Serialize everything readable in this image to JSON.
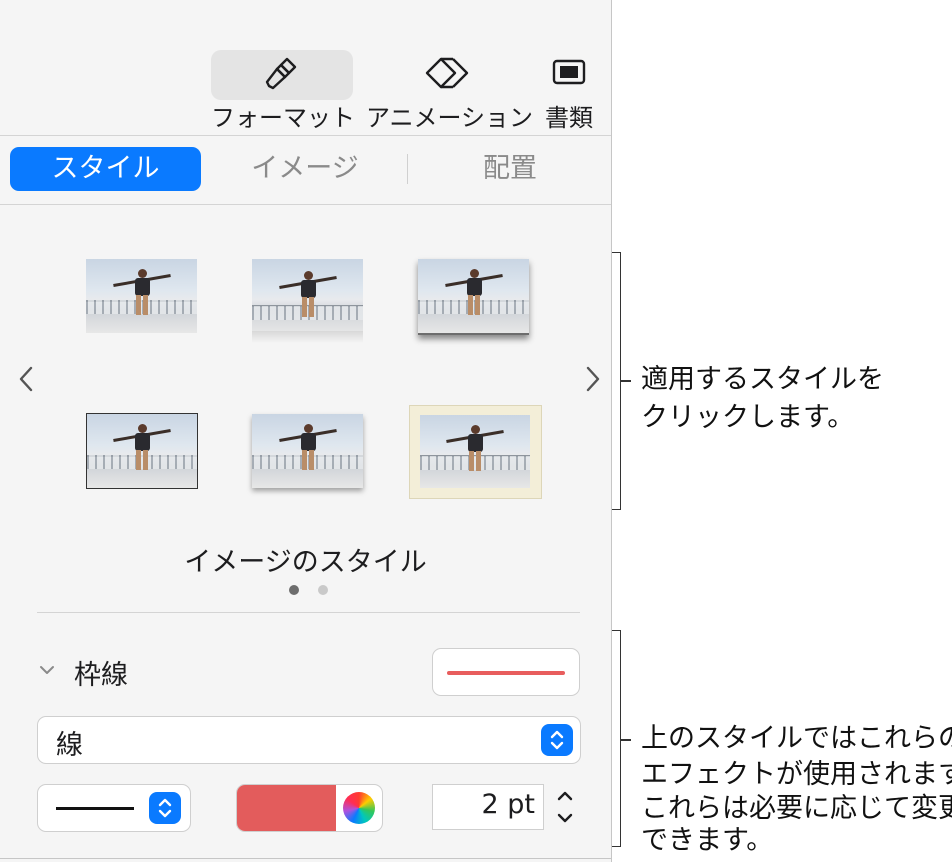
{
  "toolbar": {
    "format_label": "フォーマット",
    "animation_label": "アニメーション",
    "document_label": "書類"
  },
  "tabs": {
    "style": "スタイル",
    "image": "イメージ",
    "arrange": "配置"
  },
  "styles_gallery": {
    "title": "イメージのスタイル",
    "page_count": 2,
    "current_page": 1,
    "prev_icon": "chevron-left-icon",
    "next_icon": "chevron-right-icon"
  },
  "border": {
    "section_label": "枠線",
    "line_type": "線",
    "color": "#e35c5c",
    "width_value": "2 pt"
  },
  "annotations": {
    "styles_callout_line1": "適用するスタイルを",
    "styles_callout_line2": "クリックします。",
    "effects_callout_line1": "上のスタイルではこれらの",
    "effects_callout_line2": "エフェクトが使用されます。",
    "effects_callout_line3": "これらは必要に応じて変更",
    "effects_callout_line4": "できます。"
  },
  "colors": {
    "accent": "#0a7aff",
    "border_color": "#e35c5c"
  }
}
